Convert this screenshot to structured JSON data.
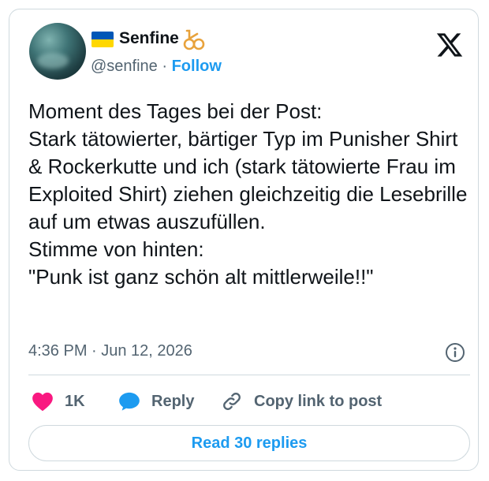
{
  "author": {
    "display_name": "Senfine",
    "handle": "@senfine",
    "separator": "·",
    "follow_label": "Follow"
  },
  "tweet": {
    "text": "Moment des Tages bei der Post:\nStark tätowierter, bärtiger Typ im Punisher Shirt & Rockerkutte und ich (stark tätowierte Frau im Exploited Shirt) ziehen gleichzeitig die Lesebrille auf um etwas auszufüllen.\nStimme von hinten:\n\"Punk ist ganz schön alt mittlerweile!!\"",
    "timestamp": "4:36 PM · Jun 12, 2026"
  },
  "actions": {
    "likes": "1K",
    "reply_label": "Reply",
    "copy_label": "Copy link to post"
  },
  "read_replies_label": "Read 30 replies",
  "colors": {
    "accent": "#1d9bf0",
    "like": "#f91880",
    "muted": "#536471",
    "border": "#cfd9de",
    "flag_blue": "#0057b7",
    "flag_yellow": "#ffd700"
  }
}
